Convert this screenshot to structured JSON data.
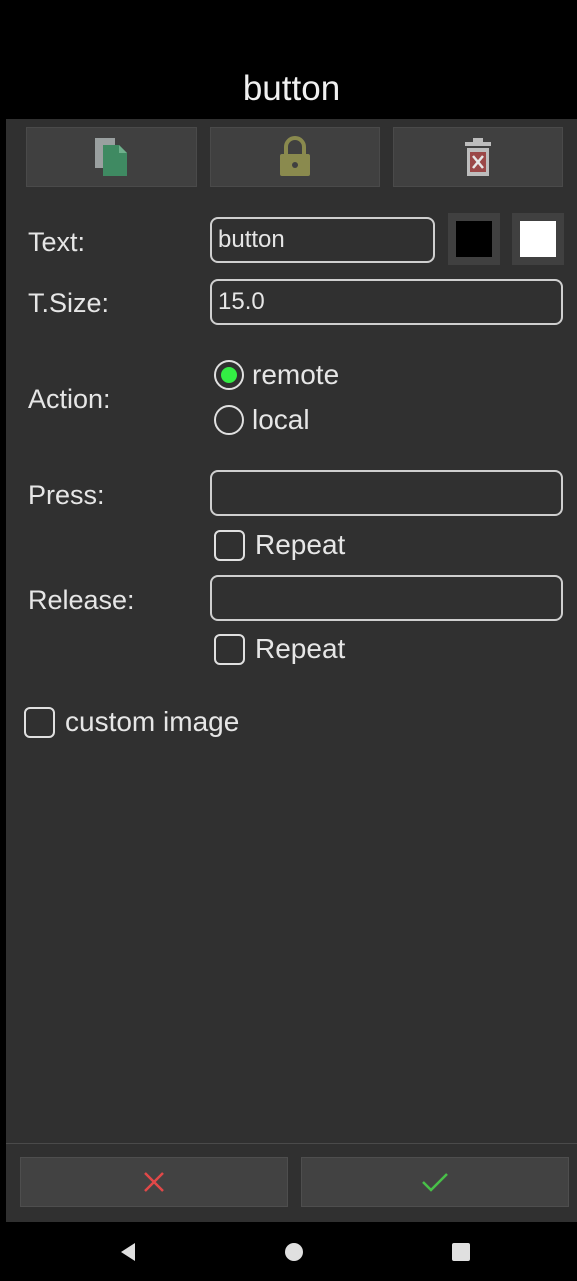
{
  "dialog": {
    "title": "button"
  },
  "toolbar": {
    "copy_icon": "copy-icon",
    "lock_icon": "lock-icon",
    "delete_icon": "delete-icon"
  },
  "form": {
    "text_label": "Text:",
    "text_value": "button",
    "text_color_black": "#000000",
    "text_color_white": "#ffffff",
    "tsize_label": "T.Size:",
    "tsize_value": "15.0",
    "action_label": "Action:",
    "action_options": [
      {
        "label": "remote",
        "selected": true
      },
      {
        "label": "local",
        "selected": false
      }
    ],
    "press_label": "Press:",
    "press_value": "",
    "press_repeat_label": "Repeat",
    "press_repeat_checked": false,
    "release_label": "Release:",
    "release_value": "",
    "release_repeat_label": "Repeat",
    "release_repeat_checked": false,
    "custom_image_label": "custom image",
    "custom_image_checked": false
  },
  "footer": {
    "cancel_icon": "close-icon",
    "confirm_icon": "check-icon",
    "cancel_color": "#e04848",
    "confirm_color": "#48c048"
  },
  "navbar": {
    "back_icon": "back-icon",
    "home_icon": "home-icon",
    "recents_icon": "recents-icon"
  }
}
